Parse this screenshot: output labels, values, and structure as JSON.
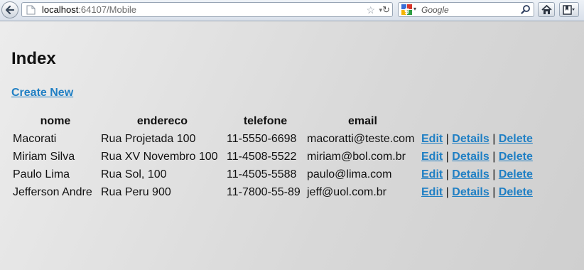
{
  "browser": {
    "url_host": "localhost",
    "url_rest": ":64107/Mobile",
    "search_placeholder": "Google"
  },
  "page": {
    "title": "Index",
    "create_new": "Create New"
  },
  "table": {
    "headers": [
      "nome",
      "endereco",
      "telefone",
      "email"
    ],
    "rows": [
      {
        "nome": "Macorati",
        "endereco": "Rua Projetada 100",
        "telefone": "11-5550-6698",
        "email": "macoratti@teste.com"
      },
      {
        "nome": "Miriam Silva",
        "endereco": "Rua XV Novembro 100",
        "telefone": "11-4508-5522",
        "email": "miriam@bol.com.br"
      },
      {
        "nome": "Paulo Lima",
        "endereco": "Rua Sol, 100",
        "telefone": "11-4505-5588",
        "email": "paulo@lima.com"
      },
      {
        "nome": "Jefferson Andre",
        "endereco": "Rua Peru 900",
        "telefone": "11-7800-55-89",
        "email": "jeff@uol.com.br"
      }
    ],
    "actions": {
      "edit": "Edit",
      "details": "Details",
      "delete": "Delete",
      "separator": "|"
    }
  },
  "colors": {
    "link": "#1f7fc4"
  }
}
